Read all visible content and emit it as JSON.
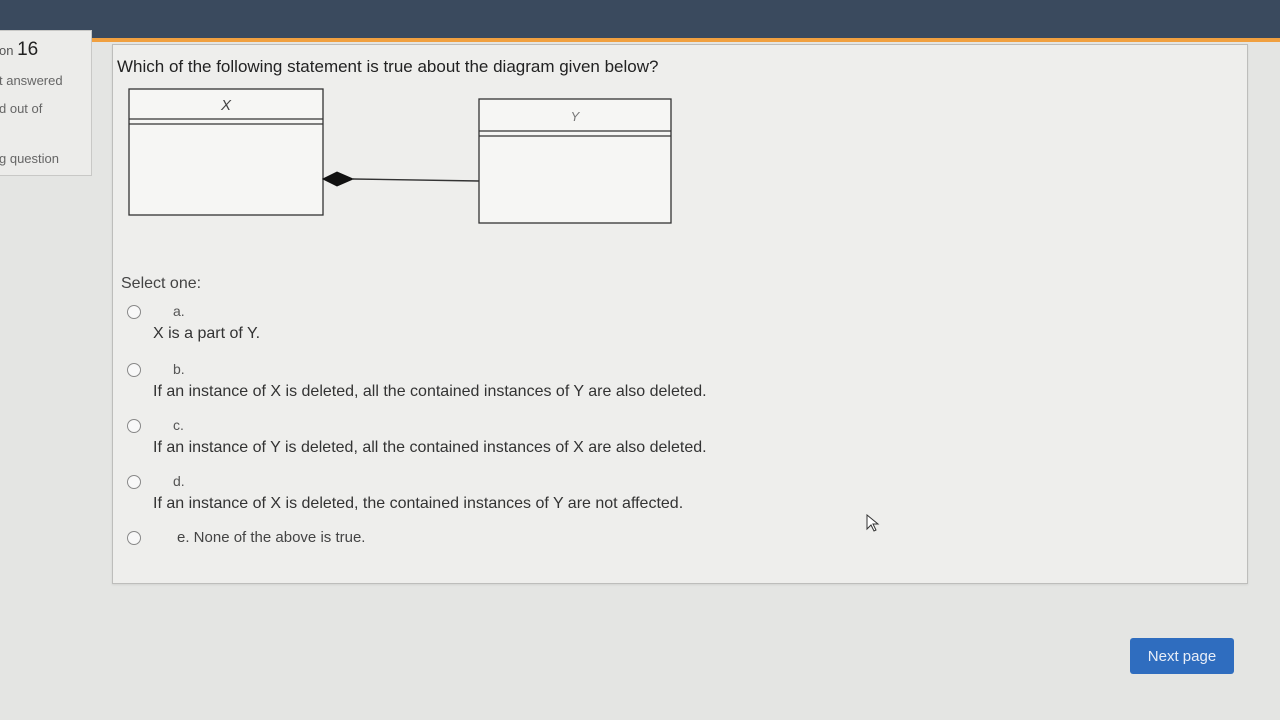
{
  "sidebar": {
    "question_prefix": "on",
    "question_number": "16",
    "status": "t answered",
    "marks": "d out of",
    "flag": "g question"
  },
  "question": {
    "text": "Which of the following statement is true about the diagram given below?",
    "diagram": {
      "class_left": "X",
      "class_right": "Y"
    },
    "select_label": "Select one:",
    "options": [
      {
        "letter": "a.",
        "text": "X is a part of Y."
      },
      {
        "letter": "b.",
        "text": "If an instance of X is deleted, all the contained instances of Y are also deleted."
      },
      {
        "letter": "c.",
        "text": "If an instance of Y is deleted, all the contained instances of X are also deleted."
      },
      {
        "letter": "d.",
        "text": "If an instance of X is deleted, the contained instances of Y are not affected."
      },
      {
        "letter": "e.",
        "text": "e. None of the above is true."
      }
    ]
  },
  "navigation": {
    "next_label": "Next page"
  },
  "colors": {
    "topbar": "#3a4a5e",
    "accent": "#f0a040",
    "button": "#2f6dbf"
  }
}
